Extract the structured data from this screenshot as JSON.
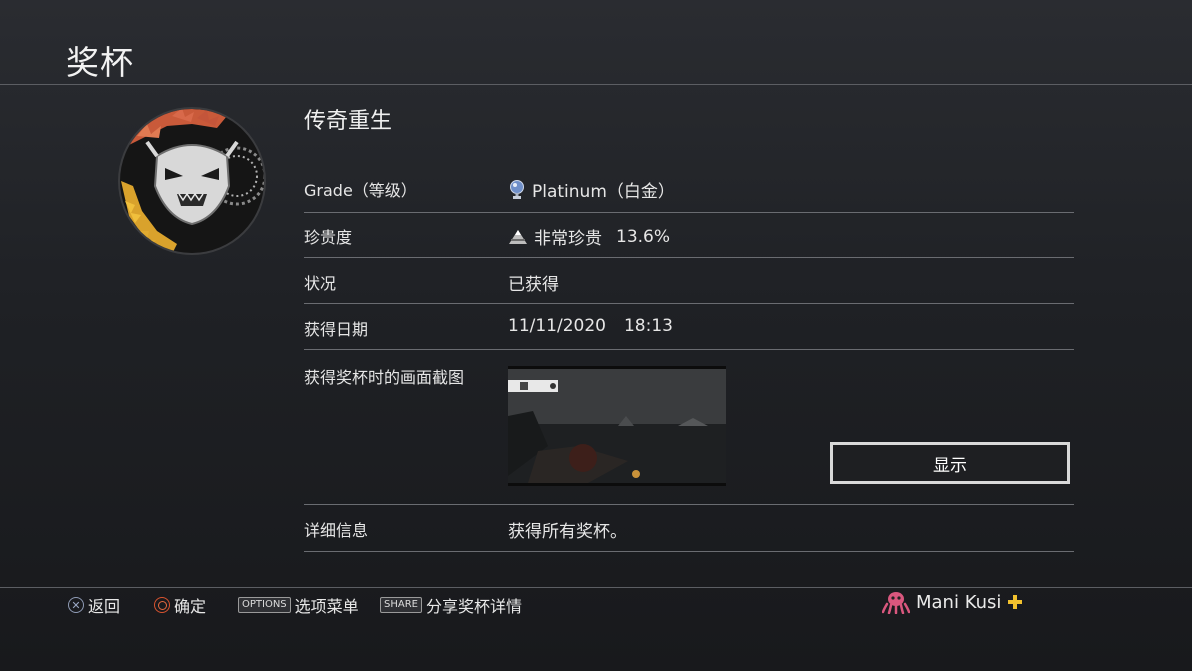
{
  "header": {
    "title": "奖杯"
  },
  "trophy": {
    "name": "传奇重生"
  },
  "details": {
    "grade": {
      "label": "Grade（等级）",
      "value": "Platinum（白金）",
      "icon": "platinum-trophy-icon"
    },
    "rarity": {
      "label": "珍贵度",
      "value": "非常珍贵",
      "percent": "13.6%",
      "icon": "rarity-triangle-icon"
    },
    "status": {
      "label": "状况",
      "value": "已获得"
    },
    "date": {
      "label": "获得日期",
      "date": "11/11/2020",
      "time": "18:13"
    },
    "screenshot": {
      "label": "获得奖杯时的画面截图",
      "button_label": "显示"
    },
    "info": {
      "label": "详细信息",
      "value": "获得所有奖杯。"
    }
  },
  "footer": {
    "back_label": "返回",
    "confirm_label": "确定",
    "options_tag": "OPTIONS",
    "options_label": "选项菜单",
    "share_tag": "SHARE",
    "share_label": "分享奖杯详情"
  },
  "user": {
    "name": "Mani Kusi",
    "plus_icon": "ps-plus-icon",
    "avatar_icon": "octopus-avatar-icon"
  },
  "colors": {
    "background": "#1f2125",
    "divider": "#6a6c71",
    "plus": "#f2c12e",
    "circle_button": "#d9532f"
  }
}
